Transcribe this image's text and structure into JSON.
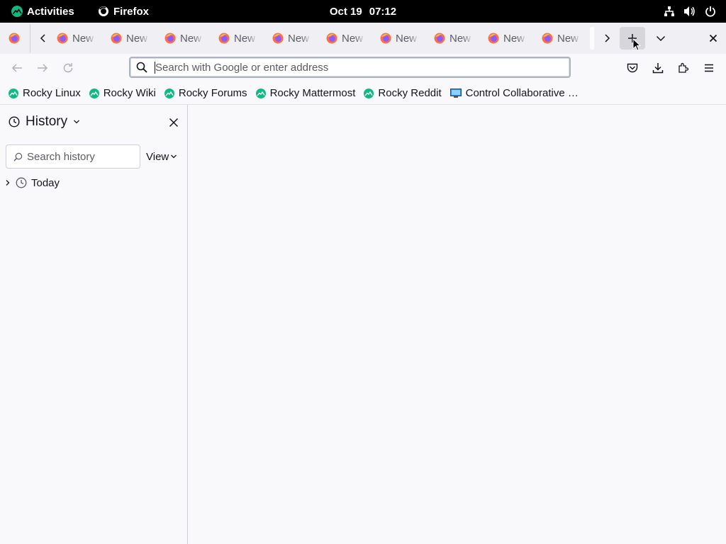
{
  "system_bar": {
    "activities_label": "Activities",
    "app_name": "Firefox",
    "date": "Oct 19",
    "time": "07:12",
    "tray_icons": [
      "network-icon",
      "volume-icon",
      "power-icon"
    ]
  },
  "tabs": [
    {
      "label": "New Tab"
    },
    {
      "label": "New Tab"
    },
    {
      "label": "New Tab"
    },
    {
      "label": "New Tab"
    },
    {
      "label": "New Tab"
    },
    {
      "label": "New Tab"
    },
    {
      "label": "New Tab"
    },
    {
      "label": "New Tab"
    },
    {
      "label": "New Tab"
    },
    {
      "label": "New Tab"
    }
  ],
  "toolbar": {
    "url_placeholder": "Search with Google or enter address",
    "url_value": ""
  },
  "bookmarks": [
    {
      "label": "Rocky Linux",
      "icon": "rocky-icon"
    },
    {
      "label": "Rocky Wiki",
      "icon": "rocky-icon"
    },
    {
      "label": "Rocky Forums",
      "icon": "rocky-icon"
    },
    {
      "label": "Rocky Mattermost",
      "icon": "rocky-icon"
    },
    {
      "label": "Rocky Reddit",
      "icon": "rocky-icon"
    },
    {
      "label": "Control Collaborative …",
      "icon": "monitor-icon"
    }
  ],
  "sidebar": {
    "title": "History",
    "search_placeholder": "Search history",
    "view_label": "View",
    "items": [
      {
        "label": "Today",
        "expanded": false
      }
    ]
  },
  "colors": {
    "accent": "#0061e0",
    "rocky_green": "#10b981",
    "firefox_orange": "#ff7139"
  }
}
